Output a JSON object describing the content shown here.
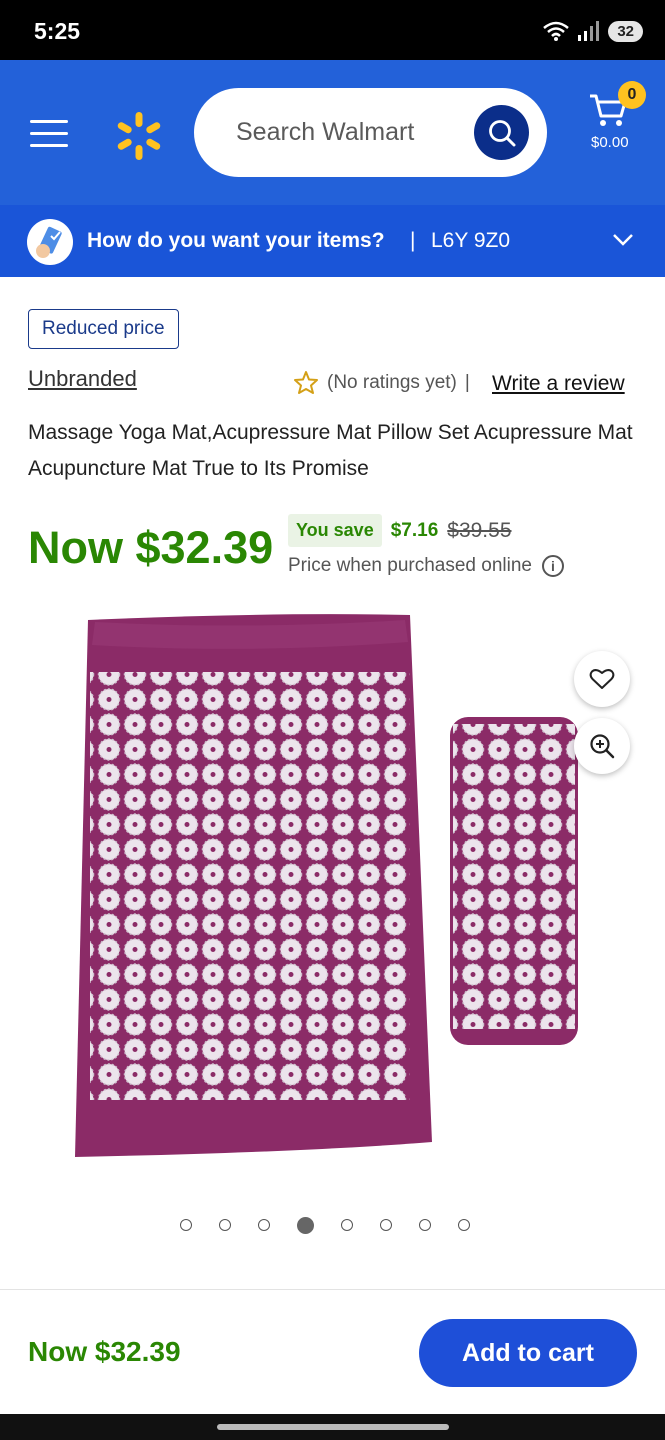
{
  "status_bar": {
    "time": "5:25",
    "battery": "32"
  },
  "header": {
    "search_placeholder": "Search Walmart",
    "cart_count": "0",
    "cart_total": "$0.00",
    "colors": {
      "header_bg": "#2361d9",
      "spark": "#ffc220"
    }
  },
  "delivery": {
    "question": "How do you want your items?",
    "separator": "|",
    "postal_code": "L6Y 9Z0"
  },
  "product": {
    "badge": "Reduced price",
    "brand": "Unbranded",
    "ratings_text": "(No ratings yet)",
    "ratings_separator": "|",
    "write_review": "Write a review",
    "title": "Massage Yoga Mat,Acupressure Mat Pillow Set Acupressure Mat Acupuncture Mat True to Its Promise",
    "price_now": "Now $32.39",
    "you_save_label": "You save",
    "save_amount": "$7.16",
    "was_price": "$39.55",
    "price_note": "Price when purchased online",
    "image_count": 8,
    "active_image_index": 3,
    "colors": {
      "price": "#2a8703",
      "mat": "#8b2b67"
    }
  },
  "footer": {
    "price": "Now $32.39",
    "add_to_cart": "Add to cart"
  }
}
